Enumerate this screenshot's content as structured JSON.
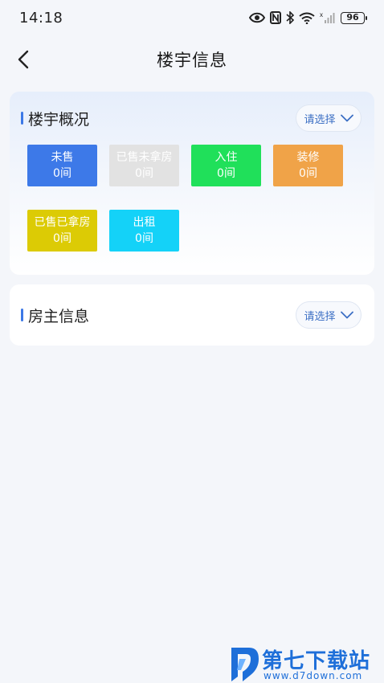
{
  "status_bar": {
    "time": "14:18",
    "battery": "96"
  },
  "header": {
    "title": "楼宇信息"
  },
  "building_card": {
    "title": "楼宇概况",
    "select_label": "请选择",
    "tiles": [
      {
        "name": "未售",
        "count": "0间",
        "color": "#3d79e8"
      },
      {
        "name": "已售未拿房",
        "count": "0间",
        "color": "#e2e2e2"
      },
      {
        "name": "入住",
        "count": "0间",
        "color": "#20e05a"
      },
      {
        "name": "装修",
        "count": "0间",
        "color": "#f0a348"
      },
      {
        "name": "已售已拿房",
        "count": "0间",
        "color": "#dccb05"
      },
      {
        "name": "出租",
        "count": "0间",
        "color": "#14d2f8"
      }
    ]
  },
  "owner_card": {
    "title": "房主信息",
    "select_label": "请选择"
  },
  "watermark": {
    "title": "第七下载站",
    "url": "www.d7down.com"
  },
  "colors": {
    "accent": "#3c78e6",
    "background": "#f4f6fa"
  }
}
